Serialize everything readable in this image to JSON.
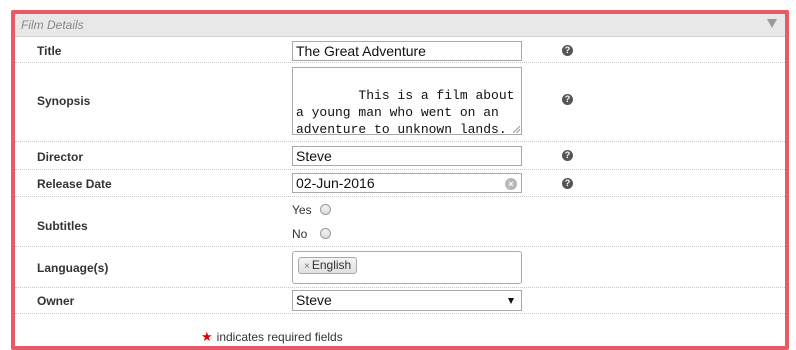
{
  "panel": {
    "title": "Film Details"
  },
  "fields": {
    "title": {
      "label": "Title",
      "value": "The Great Adventure"
    },
    "synopsis": {
      "label": "Synopsis",
      "value": "This is a film about a young man who went on an adventure to unknown lands."
    },
    "director": {
      "label": "Director",
      "value": "Steve"
    },
    "release_date": {
      "label": "Release Date",
      "value": "02-Jun-2016"
    },
    "subtitles": {
      "label": "Subtitles",
      "options": [
        "Yes",
        "No"
      ],
      "selected": null
    },
    "languages": {
      "label": "Language(s)",
      "tags": [
        "English"
      ],
      "remove_glyph": "×"
    },
    "owner": {
      "label": "Owner",
      "value": "Steve"
    }
  },
  "help_glyph": "?",
  "clear_glyph": "×",
  "footer": {
    "required_star": "★",
    "required_text": "indicates required fields"
  },
  "colors": {
    "frame_border": "#e85b65",
    "header_bg": "#e8e8e8",
    "required_star": "#e00000"
  },
  "icons": {
    "collapse": "triangle-down-icon",
    "help": "question-circle-icon",
    "clear": "clear-circle-icon",
    "select_arrow": "caret-down-icon"
  }
}
